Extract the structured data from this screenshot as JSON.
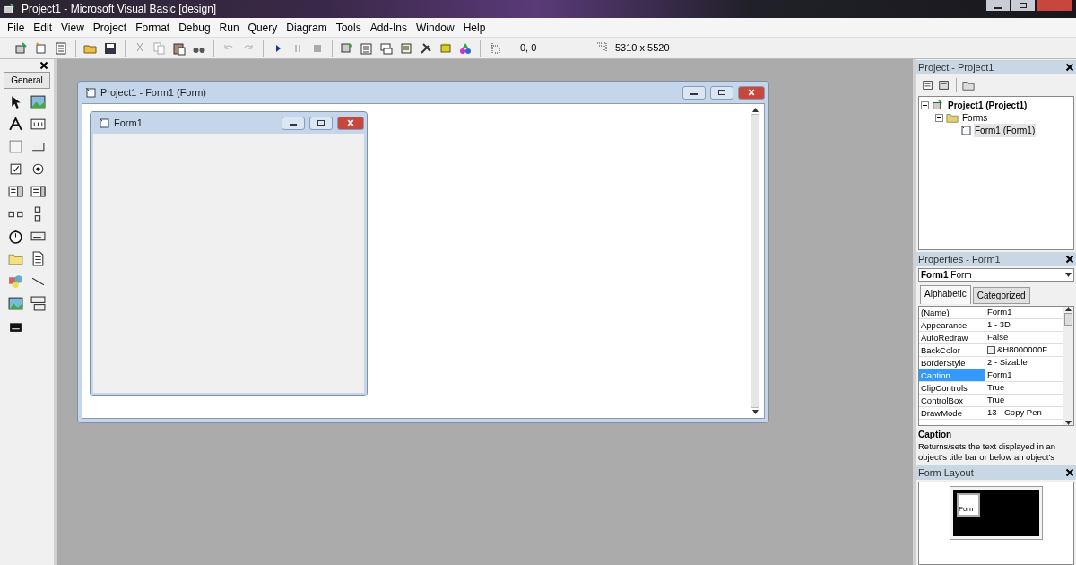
{
  "window": {
    "title": "Project1 - Microsoft Visual Basic [design]"
  },
  "menu": [
    "File",
    "Edit",
    "View",
    "Project",
    "Format",
    "Debug",
    "Run",
    "Query",
    "Diagram",
    "Tools",
    "Add-Ins",
    "Window",
    "Help"
  ],
  "toolbar": {
    "position": "0, 0",
    "size": "5310 x 5520"
  },
  "toolbox": {
    "tab": "General"
  },
  "designer": {
    "title": "Project1 - Form1 (Form)",
    "form_caption": "Form1"
  },
  "project": {
    "title": "Project - Project1",
    "tree": [
      {
        "label": "Project1 (Project1)",
        "kind": "project",
        "expanded": true,
        "selected": false,
        "children": [
          {
            "label": "Forms",
            "kind": "folder",
            "expanded": true,
            "selected": false,
            "children": [
              {
                "label": "Form1 (Form1)",
                "kind": "form",
                "selected": true
              }
            ]
          }
        ]
      }
    ]
  },
  "properties": {
    "title": "Properties - Form1",
    "object_name": "Form1",
    "object_type": "Form",
    "tabs": [
      {
        "label": "Alphabetic",
        "selected": true
      },
      {
        "label": "Categorized",
        "selected": false
      }
    ],
    "rows": [
      {
        "name": "(Name)",
        "value": "Form1",
        "selected": false
      },
      {
        "name": "Appearance",
        "value": "1 - 3D",
        "selected": false
      },
      {
        "name": "AutoRedraw",
        "value": "False",
        "selected": false
      },
      {
        "name": "BackColor",
        "value": "&H8000000F",
        "selected": false,
        "kind": "color"
      },
      {
        "name": "BorderStyle",
        "value": "2 - Sizable",
        "selected": false
      },
      {
        "name": "Caption",
        "value": "Form1",
        "selected": true
      },
      {
        "name": "ClipControls",
        "value": "True",
        "selected": false
      },
      {
        "name": "ControlBox",
        "value": "True",
        "selected": false
      },
      {
        "name": "DrawMode",
        "value": "13 - Copy Pen",
        "selected": false
      }
    ],
    "help_title": "Caption",
    "help_text": "Returns/sets the text displayed in an object's title bar or below an object's"
  },
  "form_layout": {
    "title": "Form Layout",
    "preview_caption": "Forn"
  }
}
